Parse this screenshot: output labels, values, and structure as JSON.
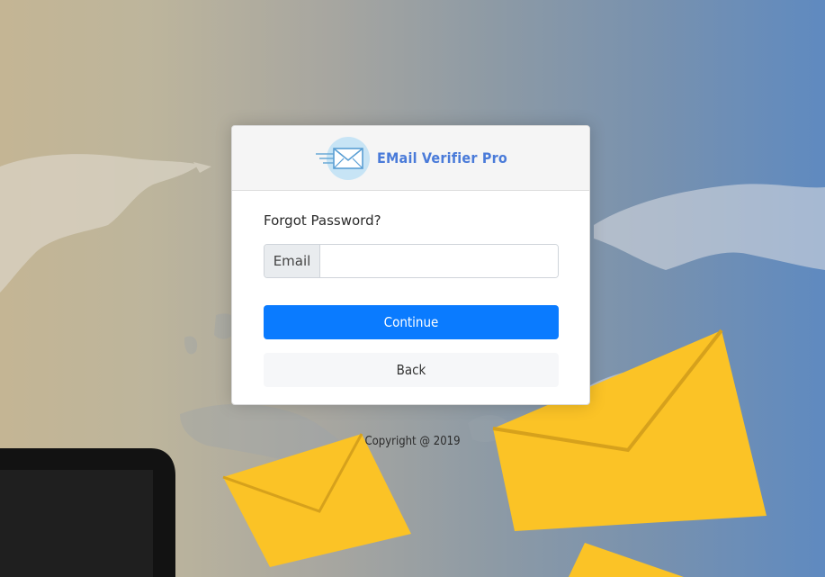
{
  "app": {
    "brand": "EMail Verifier Pro",
    "logo_icon": "envelope-fast-icon"
  },
  "form": {
    "title": "Forgot Password?",
    "email_label": "Email",
    "email_value": "",
    "email_placeholder": "",
    "continue_label": "Continue",
    "back_label": "Back"
  },
  "footer": {
    "copyright": "Copyright @ 2019"
  },
  "colors": {
    "brand": "#4a7bd9",
    "primary_button": "#0a7bff",
    "envelope": "#fbc326"
  }
}
